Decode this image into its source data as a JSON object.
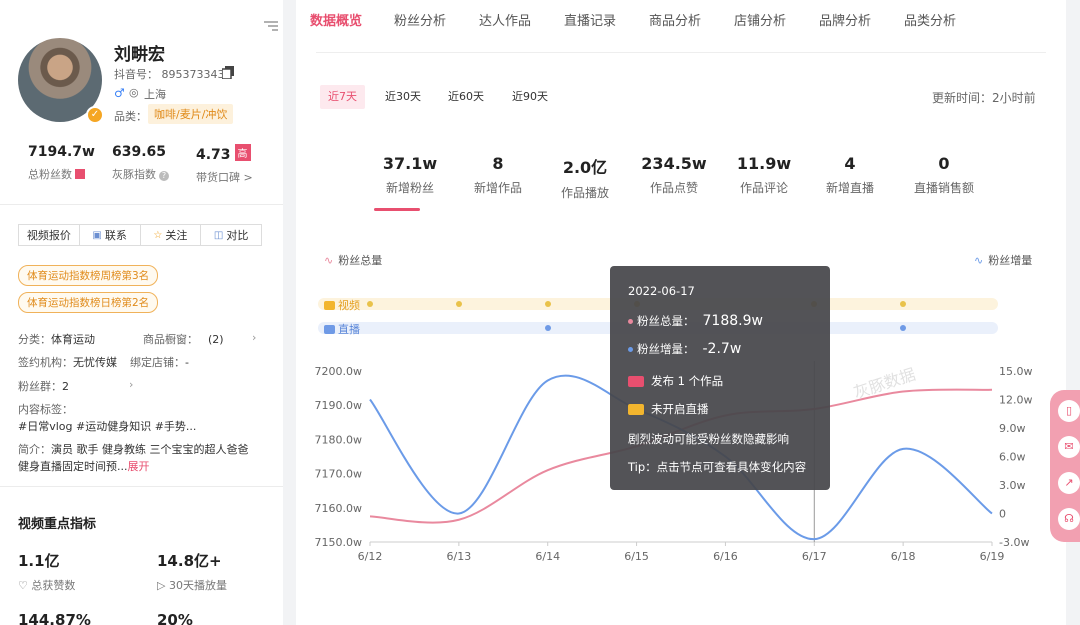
{
  "profile": {
    "name": "刘畊宏",
    "douyin_id": "抖音号： 895373343",
    "gender_icon": "male-icon",
    "location": "上海",
    "category_label": "品类：",
    "category_tag": "咖啡/麦片/冲饮"
  },
  "key_stats": [
    {
      "value": "7194.7w",
      "label": "总粉丝数"
    },
    {
      "value": "639.65",
      "label": "灰豚指数"
    },
    {
      "value": "4.73",
      "badge": "高",
      "label": "带货口碑 >"
    }
  ],
  "actions": [
    {
      "label": "视频报价",
      "icon": ""
    },
    {
      "label": "联系",
      "icon": "contact-icon"
    },
    {
      "label": "关注",
      "icon": "star-icon"
    },
    {
      "label": "对比",
      "icon": "compare-icon"
    }
  ],
  "rank_tags": [
    "体育运动指数榜周榜第3名",
    "体育运动指数榜日榜第2名"
  ],
  "info": {
    "category": "分类：",
    "category_val": "体育运动",
    "showcase": "商品橱窗：",
    "showcase_val": "(2)",
    "agency": "签约机构：",
    "agency_val": "无忧传媒",
    "shop": "绑定店铺：",
    "shop_val": "-",
    "fan_group": "粉丝群：",
    "fan_group_val": "2",
    "content_tags_label": "内容标签：",
    "content_tags": "#日常vlog  #运动健身知识  #手势...",
    "bio_label": "简介：",
    "bio_line1": "演员 歌手 健身教练 三个宝宝的超人爸爸",
    "bio_line2": "健身直播固定时间预...",
    "expand": "展开"
  },
  "video_section": {
    "title": "视频重点指标",
    "metrics": [
      {
        "value": "1.1亿",
        "label": "总获赞数",
        "icon": "heart-icon"
      },
      {
        "value": "14.8亿+",
        "label": "30天播放量",
        "icon": "play-icon"
      },
      {
        "value": "144.87%"
      },
      {
        "value": "20%"
      }
    ]
  },
  "tabs": [
    "数据概览",
    "粉丝分析",
    "达人作品",
    "直播记录",
    "商品分析",
    "店铺分析",
    "品牌分析",
    "品类分析"
  ],
  "ranges": [
    "近7天",
    "近30天",
    "近60天",
    "近90天"
  ],
  "updated": "更新时间：2小时前",
  "cards": [
    {
      "value": "37.1w",
      "label": "新增粉丝"
    },
    {
      "value": "8",
      "label": "新增作品"
    },
    {
      "value": "2.0亿",
      "label": "作品播放"
    },
    {
      "value": "234.5w",
      "label": "作品点赞"
    },
    {
      "value": "11.9w",
      "label": "作品评论"
    },
    {
      "value": "4",
      "label": "新增直播"
    },
    {
      "value": "0",
      "label": "直播销售额"
    }
  ],
  "legend": {
    "left": "粉丝总量",
    "right": "粉丝增量"
  },
  "tracks": {
    "video_label": "视频",
    "live_label": "直播"
  },
  "watermark": "灰豚数据",
  "tooltip": {
    "date": "2022-06-17",
    "total_label": "粉丝总量：",
    "total_value": "7188.9w",
    "inc_label": "粉丝增量：",
    "inc_value": "-2.7w",
    "video_line": "发布 1 个作品",
    "live_line": "未开启直播",
    "note": "剧烈波动可能受粉丝数隐藏影响",
    "tip": "Tip：点击节点可查看具体变化内容"
  },
  "colors": {
    "accent": "#e84f6f",
    "blue_line": "#6b9be8",
    "pink_line": "#e9899e",
    "video_track": "#fdf3dd",
    "live_track": "#eaf0fb"
  },
  "chart_data": {
    "type": "line",
    "x": [
      "6/12",
      "6/13",
      "6/14",
      "6/15",
      "6/16",
      "6/17",
      "6/18",
      "6/19"
    ],
    "series": [
      {
        "name": "粉丝总量",
        "axis": "left",
        "values": [
          7157.5,
          7156.5,
          7171,
          7178,
          7187,
          7188.9,
          7194,
          7194.5
        ]
      },
      {
        "name": "粉丝增量",
        "axis": "right",
        "values": [
          12.0,
          0,
          14.0,
          11.0,
          6.0,
          -2.7,
          6.8,
          0
        ]
      }
    ],
    "y_left": {
      "ticks": [
        "7150.0w",
        "7160.0w",
        "7170.0w",
        "7180.0w",
        "7190.0w",
        "7200.0w"
      ],
      "range": [
        7150,
        7200
      ]
    },
    "y_right": {
      "ticks": [
        "-3.0w",
        "0",
        "3.0w",
        "6.0w",
        "9.0w",
        "12.0w",
        "15.0w"
      ],
      "range": [
        -3,
        15
      ]
    },
    "video_markers": [
      "6/12",
      "6/13",
      "6/14",
      "6/15",
      "6/17",
      "6/18"
    ],
    "live_markers": [
      "6/14",
      "6/18"
    ],
    "highlight_x": "6/17"
  }
}
